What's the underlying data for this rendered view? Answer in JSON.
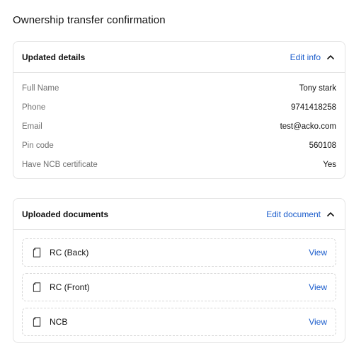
{
  "page": {
    "title": "Ownership transfer confirmation"
  },
  "details_card": {
    "title": "Updated details",
    "edit_label": "Edit info",
    "rows": [
      {
        "label": "Full Name",
        "value": "Tony stark"
      },
      {
        "label": "Phone",
        "value": "9741418258"
      },
      {
        "label": "Email",
        "value": "test@acko.com"
      },
      {
        "label": "Pin code",
        "value": "560108"
      },
      {
        "label": "Have NCB certificate",
        "value": "Yes"
      }
    ]
  },
  "documents_card": {
    "title": "Uploaded documents",
    "edit_label": "Edit document",
    "items": [
      {
        "name": "RC (Back)",
        "action": "View",
        "icon": "document-icon"
      },
      {
        "name": "RC (Front)",
        "action": "View",
        "icon": "document-icon"
      },
      {
        "name": "NCB",
        "action": "View",
        "icon": "document-icon"
      }
    ]
  },
  "colors": {
    "link": "#1b5dcc",
    "label": "#707070",
    "border": "#e4e4e4"
  }
}
